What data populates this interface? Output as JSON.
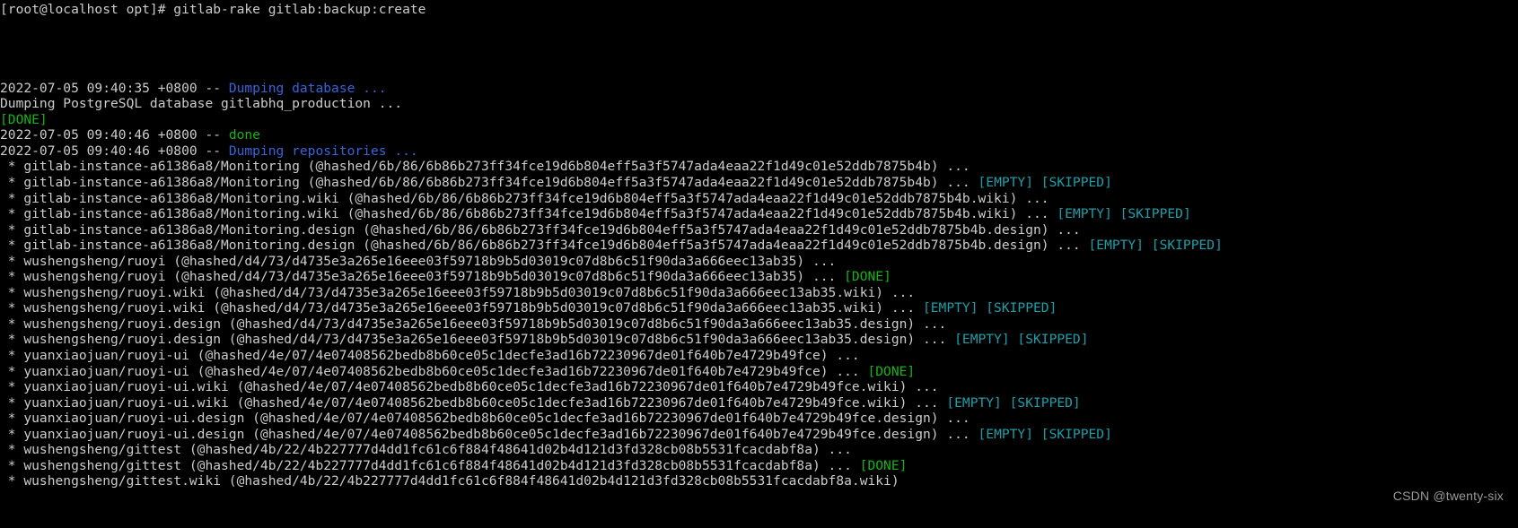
{
  "terminal": {
    "prompt_line": "[root@localhost opt]# gitlab-rake gitlab:backup:create",
    "colors": {
      "background": "#000000",
      "default_text": "#cccccc",
      "blue": "#3b63d6",
      "green": "#18b218",
      "cyan": "#1f9ea8"
    },
    "lines": [
      {
        "segments": [
          {
            "text": "[root@localhost opt]# gitlab-rake gitlab:backup:create",
            "color": "default"
          }
        ]
      },
      {
        "segments": []
      },
      {
        "segments": []
      },
      {
        "segments": []
      },
      {
        "segments": []
      },
      {
        "segments": [
          {
            "text": "2022-07-05 09:40:35 +0800 -- ",
            "color": "default"
          },
          {
            "text": "Dumping database ...",
            "color": "blue"
          }
        ]
      },
      {
        "segments": [
          {
            "text": "Dumping PostgreSQL database gitlabhq_production ... ",
            "color": "default"
          }
        ]
      },
      {
        "segments": [
          {
            "text": "[DONE]",
            "color": "green"
          }
        ]
      },
      {
        "segments": [
          {
            "text": "2022-07-05 09:40:46 +0800 -- ",
            "color": "default"
          },
          {
            "text": "done",
            "color": "green"
          }
        ]
      },
      {
        "segments": [
          {
            "text": "2022-07-05 09:40:46 +0800 -- ",
            "color": "default"
          },
          {
            "text": "Dumping repositories ...",
            "color": "blue"
          }
        ]
      },
      {
        "segments": [
          {
            "text": " * gitlab-instance-a61386a8/Monitoring (@hashed/6b/86/6b86b273ff34fce19d6b804eff5a3f5747ada4eaa22f1d49c01e52ddb7875b4b) ... ",
            "color": "default"
          }
        ]
      },
      {
        "segments": [
          {
            "text": " * gitlab-instance-a61386a8/Monitoring (@hashed/6b/86/6b86b273ff34fce19d6b804eff5a3f5747ada4eaa22f1d49c01e52ddb7875b4b) ... ",
            "color": "default"
          },
          {
            "text": "[EMPTY] [SKIPPED]",
            "color": "cyan"
          }
        ]
      },
      {
        "segments": [
          {
            "text": " * gitlab-instance-a61386a8/Monitoring.wiki (@hashed/6b/86/6b86b273ff34fce19d6b804eff5a3f5747ada4eaa22f1d49c01e52ddb7875b4b.wiki) ... ",
            "color": "default"
          }
        ]
      },
      {
        "segments": [
          {
            "text": " * gitlab-instance-a61386a8/Monitoring.wiki (@hashed/6b/86/6b86b273ff34fce19d6b804eff5a3f5747ada4eaa22f1d49c01e52ddb7875b4b.wiki) ... ",
            "color": "default"
          },
          {
            "text": "[EMPTY] [SKIPPED]",
            "color": "cyan"
          }
        ]
      },
      {
        "segments": [
          {
            "text": " * gitlab-instance-a61386a8/Monitoring.design (@hashed/6b/86/6b86b273ff34fce19d6b804eff5a3f5747ada4eaa22f1d49c01e52ddb7875b4b.design) ... ",
            "color": "default"
          }
        ]
      },
      {
        "segments": [
          {
            "text": " * gitlab-instance-a61386a8/Monitoring.design (@hashed/6b/86/6b86b273ff34fce19d6b804eff5a3f5747ada4eaa22f1d49c01e52ddb7875b4b.design) ... ",
            "color": "default"
          },
          {
            "text": "[EMPTY] [SKIPPED]",
            "color": "cyan"
          }
        ]
      },
      {
        "segments": [
          {
            "text": " * wushengsheng/ruoyi (@hashed/d4/73/d4735e3a265e16eee03f59718b9b5d03019c07d8b6c51f90da3a666eec13ab35) ... ",
            "color": "default"
          }
        ]
      },
      {
        "segments": [
          {
            "text": " * wushengsheng/ruoyi (@hashed/d4/73/d4735e3a265e16eee03f59718b9b5d03019c07d8b6c51f90da3a666eec13ab35) ... ",
            "color": "default"
          },
          {
            "text": "[DONE]",
            "color": "green"
          }
        ]
      },
      {
        "segments": [
          {
            "text": " * wushengsheng/ruoyi.wiki (@hashed/d4/73/d4735e3a265e16eee03f59718b9b5d03019c07d8b6c51f90da3a666eec13ab35.wiki) ... ",
            "color": "default"
          }
        ]
      },
      {
        "segments": [
          {
            "text": " * wushengsheng/ruoyi.wiki (@hashed/d4/73/d4735e3a265e16eee03f59718b9b5d03019c07d8b6c51f90da3a666eec13ab35.wiki) ... ",
            "color": "default"
          },
          {
            "text": "[EMPTY] [SKIPPED]",
            "color": "cyan"
          }
        ]
      },
      {
        "segments": [
          {
            "text": " * wushengsheng/ruoyi.design (@hashed/d4/73/d4735e3a265e16eee03f59718b9b5d03019c07d8b6c51f90da3a666eec13ab35.design) ... ",
            "color": "default"
          }
        ]
      },
      {
        "segments": [
          {
            "text": " * wushengsheng/ruoyi.design (@hashed/d4/73/d4735e3a265e16eee03f59718b9b5d03019c07d8b6c51f90da3a666eec13ab35.design) ... ",
            "color": "default"
          },
          {
            "text": "[EMPTY] [SKIPPED]",
            "color": "cyan"
          }
        ]
      },
      {
        "segments": [
          {
            "text": " * yuanxiaojuan/ruoyi-ui (@hashed/4e/07/4e07408562bedb8b60ce05c1decfe3ad16b72230967de01f640b7e4729b49fce) ... ",
            "color": "default"
          }
        ]
      },
      {
        "segments": [
          {
            "text": " * yuanxiaojuan/ruoyi-ui (@hashed/4e/07/4e07408562bedb8b60ce05c1decfe3ad16b72230967de01f640b7e4729b49fce) ... ",
            "color": "default"
          },
          {
            "text": "[DONE]",
            "color": "green"
          }
        ]
      },
      {
        "segments": [
          {
            "text": " * yuanxiaojuan/ruoyi-ui.wiki (@hashed/4e/07/4e07408562bedb8b60ce05c1decfe3ad16b72230967de01f640b7e4729b49fce.wiki) ... ",
            "color": "default"
          }
        ]
      },
      {
        "segments": [
          {
            "text": " * yuanxiaojuan/ruoyi-ui.wiki (@hashed/4e/07/4e07408562bedb8b60ce05c1decfe3ad16b72230967de01f640b7e4729b49fce.wiki) ... ",
            "color": "default"
          },
          {
            "text": "[EMPTY] [SKIPPED]",
            "color": "cyan"
          }
        ]
      },
      {
        "segments": [
          {
            "text": " * yuanxiaojuan/ruoyi-ui.design (@hashed/4e/07/4e07408562bedb8b60ce05c1decfe3ad16b72230967de01f640b7e4729b49fce.design) ... ",
            "color": "default"
          }
        ]
      },
      {
        "segments": [
          {
            "text": " * yuanxiaojuan/ruoyi-ui.design (@hashed/4e/07/4e07408562bedb8b60ce05c1decfe3ad16b72230967de01f640b7e4729b49fce.design) ... ",
            "color": "default"
          },
          {
            "text": "[EMPTY] [SKIPPED]",
            "color": "cyan"
          }
        ]
      },
      {
        "segments": [
          {
            "text": " * wushengsheng/gittest (@hashed/4b/22/4b227777d4dd1fc61c6f884f48641d02b4d121d3fd328cb08b5531fcacdabf8a) ... ",
            "color": "default"
          }
        ]
      },
      {
        "segments": [
          {
            "text": " * wushengsheng/gittest (@hashed/4b/22/4b227777d4dd1fc61c6f884f48641d02b4d121d3fd328cb08b5531fcacdabf8a) ... ",
            "color": "default"
          },
          {
            "text": "[DONE]",
            "color": "green"
          }
        ]
      },
      {
        "segments": [
          {
            "text": " * wushengsheng/gittest.wiki (@hashed/4b/22/4b227777d4dd1fc61c6f884f48641d02b4d121d3fd328cb08b5531fcacdabf8a.wiki)",
            "color": "default"
          }
        ]
      }
    ]
  },
  "watermark": {
    "text": "CSDN @twenty-six"
  }
}
